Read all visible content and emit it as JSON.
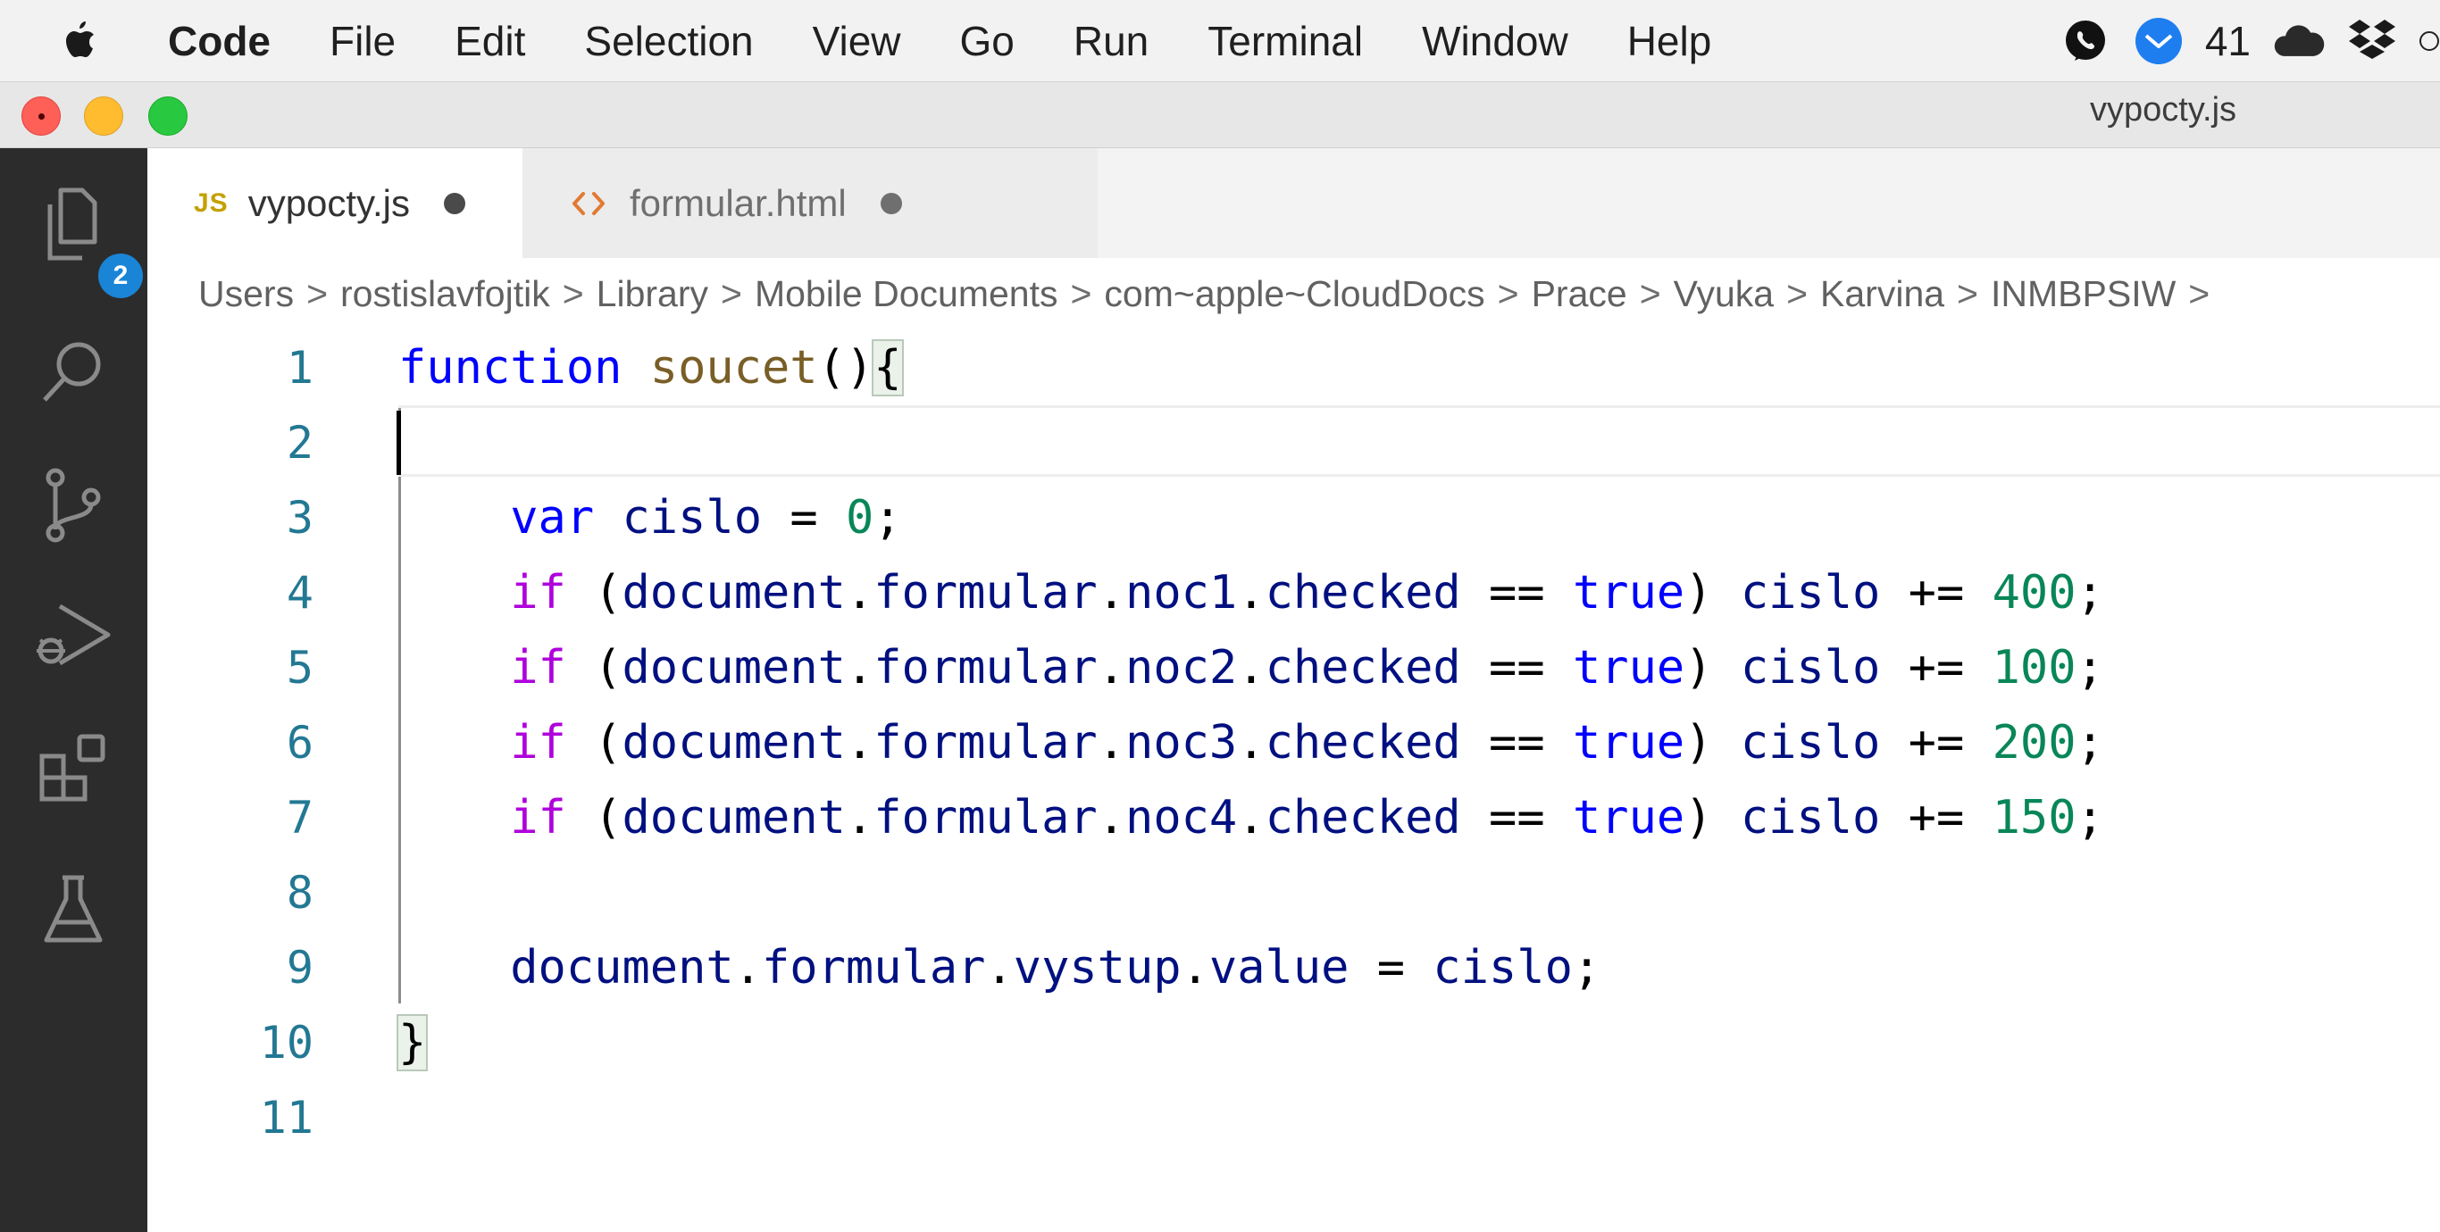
{
  "menubar": {
    "app_name": "Code",
    "items": [
      "File",
      "Edit",
      "Selection",
      "View",
      "Go",
      "Run",
      "Terminal",
      "Window",
      "Help"
    ],
    "notification_count": "41"
  },
  "window": {
    "title": "vypocty.js"
  },
  "activity_bar": {
    "explorer_badge": "2"
  },
  "tabs": [
    {
      "label": "vypocty.js",
      "icon": "JS",
      "active": true,
      "modified": true
    },
    {
      "label": "formular.html",
      "icon": "html-icon",
      "active": false,
      "modified": true
    }
  ],
  "breadcrumb": [
    "Users",
    "rostislavfojtik",
    "Library",
    "Mobile Documents",
    "com~apple~CloudDocs",
    "Prace",
    "Vyuka",
    "Karvina",
    "INMBPSIW"
  ],
  "editor": {
    "line_numbers": [
      "1",
      "2",
      "3",
      "4",
      "5",
      "6",
      "7",
      "8",
      "9",
      "10",
      "11"
    ],
    "lines": [
      [
        {
          "t": "function",
          "c": "k-blue"
        },
        {
          "t": " "
        },
        {
          "t": "soucet",
          "c": "fn"
        },
        {
          "t": "()"
        },
        {
          "t": "{",
          "c": "brace-match"
        }
      ],
      [],
      [
        {
          "t": "    "
        },
        {
          "t": "var",
          "c": "k-blue"
        },
        {
          "t": " "
        },
        {
          "t": "cislo",
          "c": "var"
        },
        {
          "t": " = "
        },
        {
          "t": "0",
          "c": "num"
        },
        {
          "t": ";"
        }
      ],
      [
        {
          "t": "    "
        },
        {
          "t": "if",
          "c": "k-ctrl"
        },
        {
          "t": " ("
        },
        {
          "t": "document",
          "c": "var"
        },
        {
          "t": "."
        },
        {
          "t": "formular",
          "c": "var"
        },
        {
          "t": "."
        },
        {
          "t": "noc1",
          "c": "var"
        },
        {
          "t": "."
        },
        {
          "t": "checked",
          "c": "var"
        },
        {
          "t": " == "
        },
        {
          "t": "true",
          "c": "k-blue"
        },
        {
          "t": ") "
        },
        {
          "t": "cislo",
          "c": "var"
        },
        {
          "t": " += "
        },
        {
          "t": "400",
          "c": "num"
        },
        {
          "t": ";"
        }
      ],
      [
        {
          "t": "    "
        },
        {
          "t": "if",
          "c": "k-ctrl"
        },
        {
          "t": " ("
        },
        {
          "t": "document",
          "c": "var"
        },
        {
          "t": "."
        },
        {
          "t": "formular",
          "c": "var"
        },
        {
          "t": "."
        },
        {
          "t": "noc2",
          "c": "var"
        },
        {
          "t": "."
        },
        {
          "t": "checked",
          "c": "var"
        },
        {
          "t": " == "
        },
        {
          "t": "true",
          "c": "k-blue"
        },
        {
          "t": ") "
        },
        {
          "t": "cislo",
          "c": "var"
        },
        {
          "t": " += "
        },
        {
          "t": "100",
          "c": "num"
        },
        {
          "t": ";"
        }
      ],
      [
        {
          "t": "    "
        },
        {
          "t": "if",
          "c": "k-ctrl"
        },
        {
          "t": " ("
        },
        {
          "t": "document",
          "c": "var"
        },
        {
          "t": "."
        },
        {
          "t": "formular",
          "c": "var"
        },
        {
          "t": "."
        },
        {
          "t": "noc3",
          "c": "var"
        },
        {
          "t": "."
        },
        {
          "t": "checked",
          "c": "var"
        },
        {
          "t": " == "
        },
        {
          "t": "true",
          "c": "k-blue"
        },
        {
          "t": ") "
        },
        {
          "t": "cislo",
          "c": "var"
        },
        {
          "t": " += "
        },
        {
          "t": "200",
          "c": "num"
        },
        {
          "t": ";"
        }
      ],
      [
        {
          "t": "    "
        },
        {
          "t": "if",
          "c": "k-ctrl"
        },
        {
          "t": " ("
        },
        {
          "t": "document",
          "c": "var"
        },
        {
          "t": "."
        },
        {
          "t": "formular",
          "c": "var"
        },
        {
          "t": "."
        },
        {
          "t": "noc4",
          "c": "var"
        },
        {
          "t": "."
        },
        {
          "t": "checked",
          "c": "var"
        },
        {
          "t": " == "
        },
        {
          "t": "true",
          "c": "k-blue"
        },
        {
          "t": ") "
        },
        {
          "t": "cislo",
          "c": "var"
        },
        {
          "t": " += "
        },
        {
          "t": "150",
          "c": "num"
        },
        {
          "t": ";"
        }
      ],
      [],
      [
        {
          "t": "    "
        },
        {
          "t": "document",
          "c": "var"
        },
        {
          "t": "."
        },
        {
          "t": "formular",
          "c": "var"
        },
        {
          "t": "."
        },
        {
          "t": "vystup",
          "c": "var"
        },
        {
          "t": "."
        },
        {
          "t": "value",
          "c": "var"
        },
        {
          "t": " = "
        },
        {
          "t": "cislo",
          "c": "var"
        },
        {
          "t": ";"
        }
      ],
      [
        {
          "t": "}",
          "c": "brace-match"
        }
      ],
      []
    ]
  },
  "colors": {
    "activity_bar_bg": "#2c2c2c",
    "badge_bg": "#1a85d6",
    "line_number": "#237893",
    "keyword": "#0000ff",
    "control_keyword": "#af00db",
    "function_name": "#795e26",
    "variable": "#001080",
    "number": "#098658"
  }
}
